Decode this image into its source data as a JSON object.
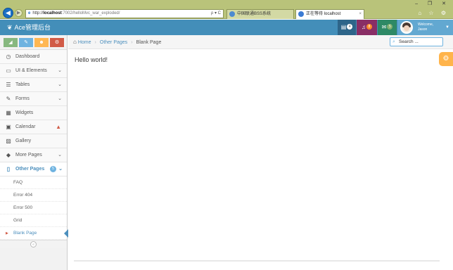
{
  "browser": {
    "url_prefix": "http://",
    "url_host": "localhost",
    "url_path": ":7002/helloMvc_war_exploded/",
    "addr_tools": "ρ ▾ C",
    "tabs": [
      {
        "title": "中国联通BSS系统",
        "active": false
      },
      {
        "title": "正在等待 localhost",
        "active": true,
        "close": "×"
      }
    ],
    "window_buttons": "–  ❐  ✕",
    "tool_icons": "⌂ ☆ ⚙"
  },
  "navbar": {
    "brand": "Ace管理后台",
    "brand_icon": "leaf-icon",
    "tasks_badge": "4",
    "notifications_badge": "8",
    "messages_badge": "5",
    "welcome": "Welcome,",
    "username": "Jason",
    "colors": {
      "bar": "#438eb9",
      "tasks": "#2e6589",
      "bell": "#892e65",
      "mail": "#2e8965",
      "user": "#62a8d1"
    }
  },
  "sidebar": {
    "shortcuts": [
      {
        "icon": "signal-icon",
        "color": "#87b87f"
      },
      {
        "icon": "pencil-icon",
        "color": "#6fb3e0"
      },
      {
        "icon": "users-icon",
        "color": "#ffb752"
      },
      {
        "icon": "cogs-icon",
        "color": "#d15b47"
      }
    ],
    "items": [
      {
        "label": "Dashboard",
        "icon": "dashboard-icon"
      },
      {
        "label": "UI & Elements",
        "icon": "desktop-icon",
        "has_caret": true
      },
      {
        "label": "Tables",
        "icon": "list-icon",
        "has_caret": true
      },
      {
        "label": "Forms",
        "icon": "edit-icon",
        "has_caret": true
      },
      {
        "label": "Widgets",
        "icon": "widgets-icon"
      },
      {
        "label": "Calendar",
        "icon": "calendar-icon",
        "warning": true
      },
      {
        "label": "Gallery",
        "icon": "picture-icon"
      },
      {
        "label": "More Pages",
        "icon": "tag-icon",
        "has_caret": true
      },
      {
        "label": "Other Pages",
        "icon": "file-icon",
        "badge": "5",
        "open": true
      }
    ],
    "submenu": [
      {
        "label": "FAQ"
      },
      {
        "label": "Error 404"
      },
      {
        "label": "Error 500"
      },
      {
        "label": "Grid"
      },
      {
        "label": "Blank Page",
        "active": true
      }
    ]
  },
  "breadcrumbs": {
    "home": "Home",
    "parent": "Other Pages",
    "current": "Blank Page",
    "separator": "›"
  },
  "search": {
    "placeholder": "Search ..."
  },
  "main": {
    "content": "Hello world!"
  }
}
